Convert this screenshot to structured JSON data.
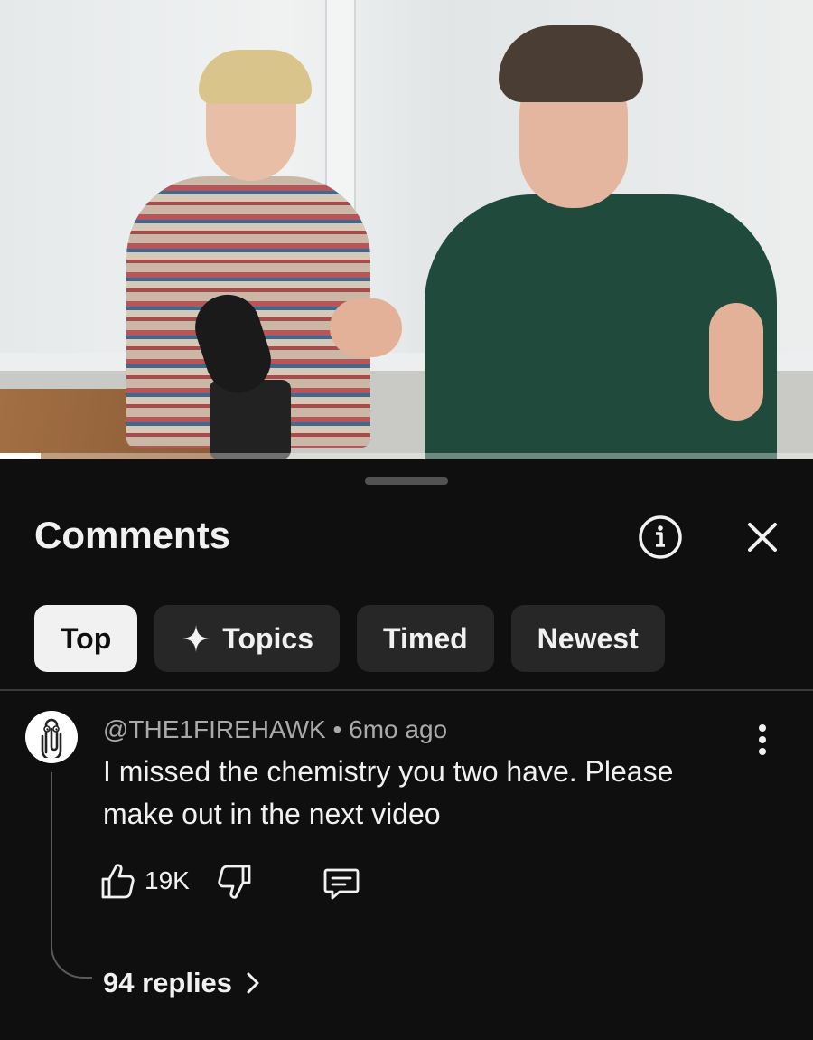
{
  "video": {
    "progress_fraction": 0.05
  },
  "comments_panel": {
    "title": "Comments",
    "info_icon": "info-circle-icon",
    "close_icon": "close-x-icon",
    "filters": [
      {
        "label": "Top",
        "active": true
      },
      {
        "label": "Topics",
        "icon": "sparkle-icon",
        "active": false
      },
      {
        "label": "Timed",
        "active": false
      },
      {
        "label": "Newest",
        "active": false
      }
    ]
  },
  "comment": {
    "avatar_icon": "paperclip-avatar-icon",
    "author": "@THE1FIREHAWK",
    "separator": "•",
    "time": "6mo ago",
    "text": "I missed the chemistry you two have. Please make out in the next video",
    "likes": "19K",
    "replies_label": "94 replies"
  },
  "colors": {
    "background": "#0f0f0f",
    "chip": "#272727",
    "chip_active": "#f1f1f1",
    "text": "#f1f1f1",
    "muted_text": "#aaaaaa"
  }
}
